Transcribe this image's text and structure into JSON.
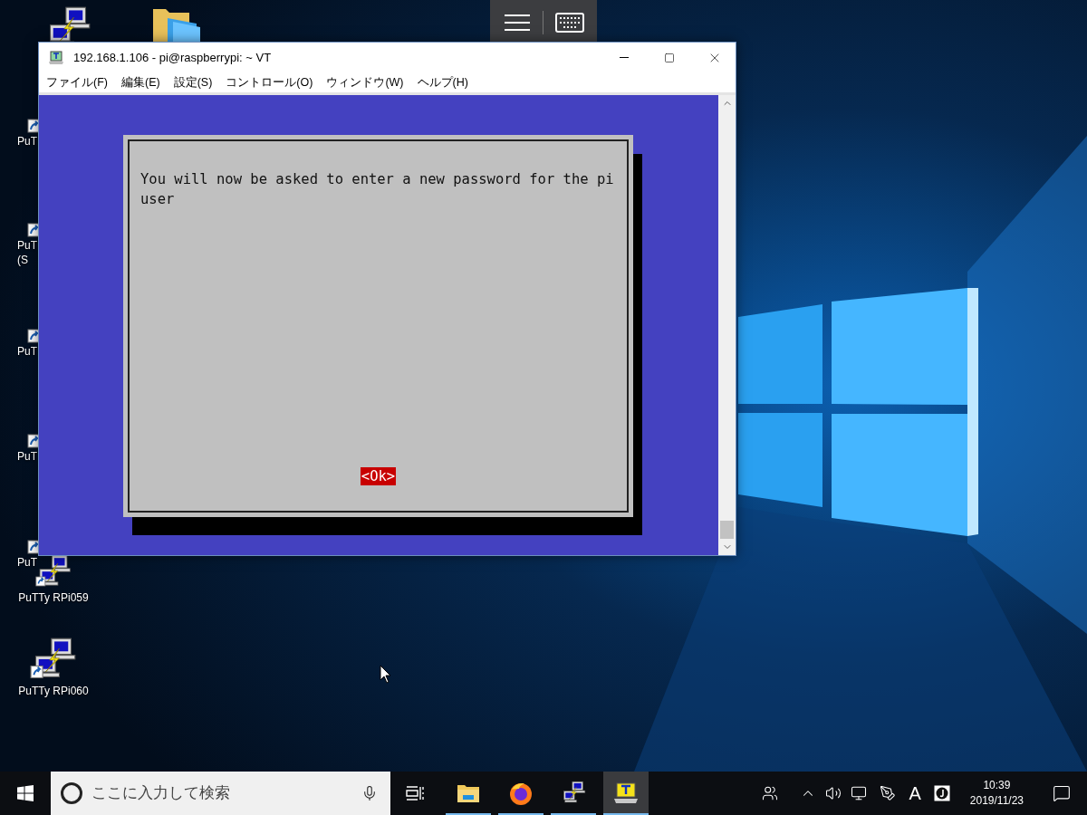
{
  "desktop": {
    "icons": [
      {
        "kind": "putty"
      },
      {
        "kind": "folder"
      },
      {
        "kind": "shortcut",
        "lines": [
          "PuT"
        ]
      },
      {
        "kind": "shortcut",
        "lines": [
          "PuT",
          "(S"
        ]
      },
      {
        "kind": "shortcut",
        "lines": [
          "PuT"
        ]
      },
      {
        "kind": "shortcut",
        "lines": [
          "PuT"
        ]
      },
      {
        "kind": "shortcut",
        "lines": [
          "PuT"
        ]
      },
      {
        "kind": "putty",
        "lines": [
          "PuTTy RPi059"
        ]
      },
      {
        "kind": "putty",
        "lines": [
          "PuTTy RPi060"
        ]
      }
    ]
  },
  "window": {
    "title": "192.168.1.106 - pi@raspberrypi: ~ VT",
    "menu": [
      "ファイル(F)",
      "編集(E)",
      "設定(S)",
      "コントロール(O)",
      "ウィンドウ(W)",
      "ヘルプ(H)"
    ],
    "dialog": {
      "message_lines": [
        "You will now be asked to enter a new password for the pi",
        "user"
      ],
      "buttons": [
        {
          "label": "<Ok>",
          "selected": true
        }
      ]
    }
  },
  "taskbar": {
    "search": {
      "placeholder": "ここに入力して検索"
    },
    "apps": [
      {
        "kind": "folder",
        "running": true,
        "selected": false
      },
      {
        "kind": "browser",
        "running": true,
        "selected": false
      },
      {
        "kind": "putty",
        "running": true,
        "selected": false
      },
      {
        "kind": "terminal",
        "running": true,
        "selected": true
      }
    ],
    "ime_mode": "A",
    "time": "10:39",
    "date": "2019/11/23"
  }
}
